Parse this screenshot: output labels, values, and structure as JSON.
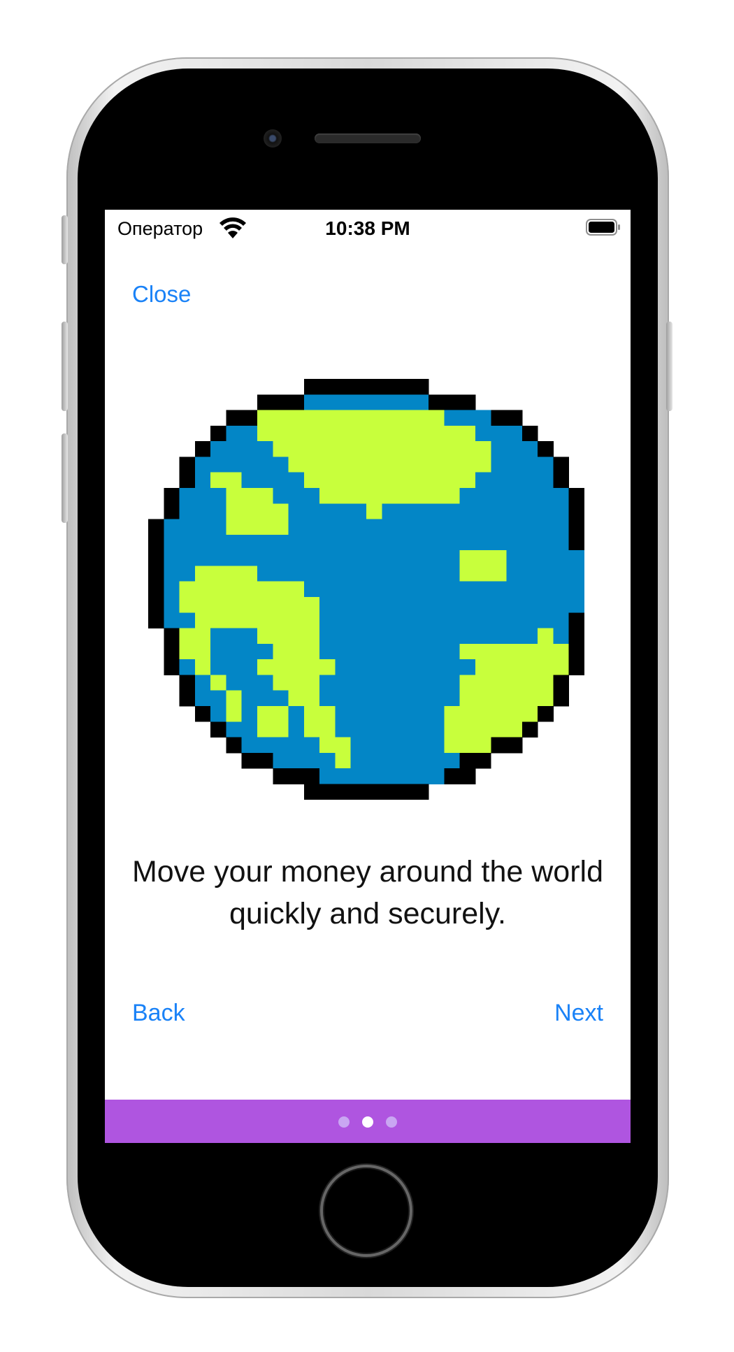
{
  "device": {
    "model": "iPhone SE",
    "frame_color": "#d9d9d9"
  },
  "status_bar": {
    "carrier": "Оператор",
    "time": "10:38 PM",
    "wifi_icon": "wifi-icon",
    "battery_icon": "battery-full-icon"
  },
  "nav": {
    "close_label": "Close"
  },
  "illustration": {
    "icon": "pixel-globe-icon",
    "colors": {
      "ocean": "#0386c6",
      "land": "#c8ff3c",
      "outline": "#000000"
    }
  },
  "onboarding": {
    "message": "Move your money around the world quickly and securely."
  },
  "footer": {
    "back_label": "Back",
    "next_label": "Next"
  },
  "page_control": {
    "color": "#af55e0",
    "total_pages": 3,
    "current_page": 2
  },
  "colors": {
    "accent": "#1a82f7",
    "text": "#111111"
  }
}
